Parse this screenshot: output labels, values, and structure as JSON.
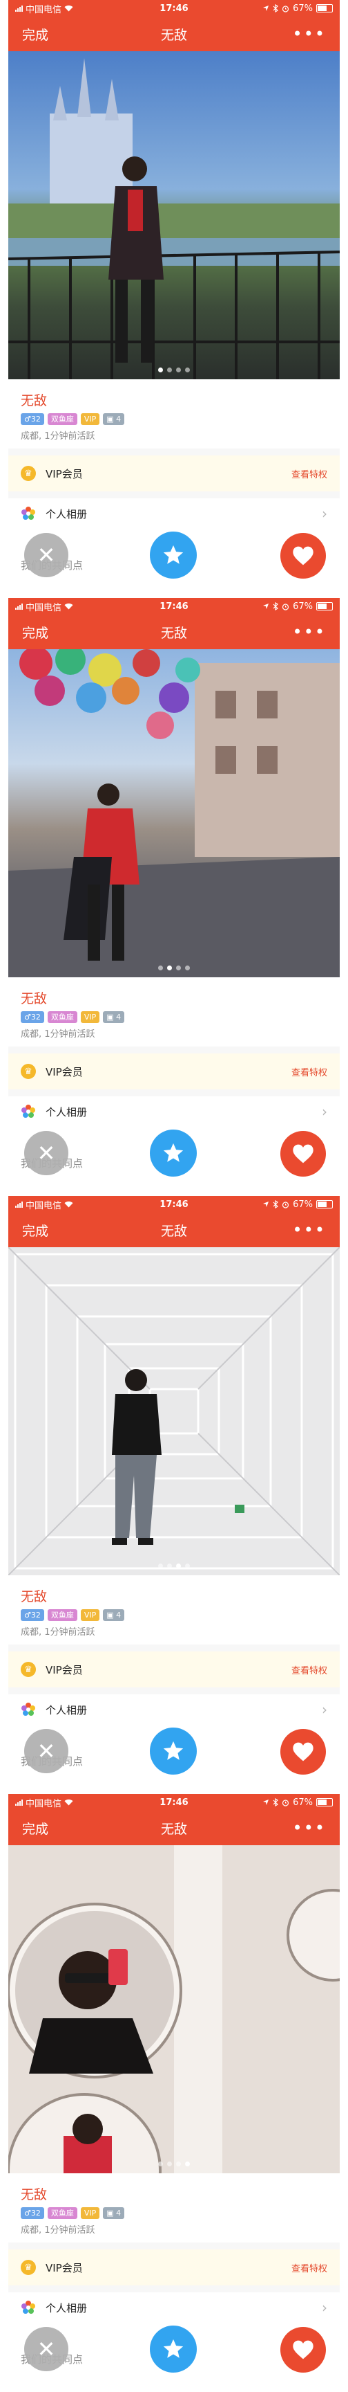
{
  "status_bar": {
    "carrier": "中国电信",
    "time": "17:46",
    "battery": "67%",
    "battery_fraction": 0.67
  },
  "nav": {
    "done": "完成",
    "title": "无敌",
    "more": "•••"
  },
  "profile": {
    "name": "无敌",
    "tags": {
      "age": "♂32",
      "zodiac": "双鱼座",
      "vip": "VIP",
      "photos": "4"
    },
    "meta": "成都, 1分钟前活跃"
  },
  "vip_row": {
    "label": "VIP会员",
    "link": "查看特权"
  },
  "album_row": {
    "label": "个人相册"
  },
  "common_label": "我们的共同点",
  "carousel": {
    "total": 4,
    "current_per_screen": [
      1,
      2,
      3,
      4
    ]
  },
  "icons": {
    "crown": "crown-icon",
    "album": "flower-icon",
    "dislike": "close-icon",
    "superlike": "star-icon",
    "like": "heart-icon",
    "wifi": "wifi-icon",
    "battery": "battery-icon"
  },
  "colors": {
    "brand": "#ea4a2f",
    "name": "#e44a2d",
    "vip_gold": "#f5b82a",
    "star_blue": "#32a4f0",
    "age_tag": "#6aa4e8",
    "zodiac_tag": "#d887d2",
    "photo_tag": "#9cabb8"
  }
}
